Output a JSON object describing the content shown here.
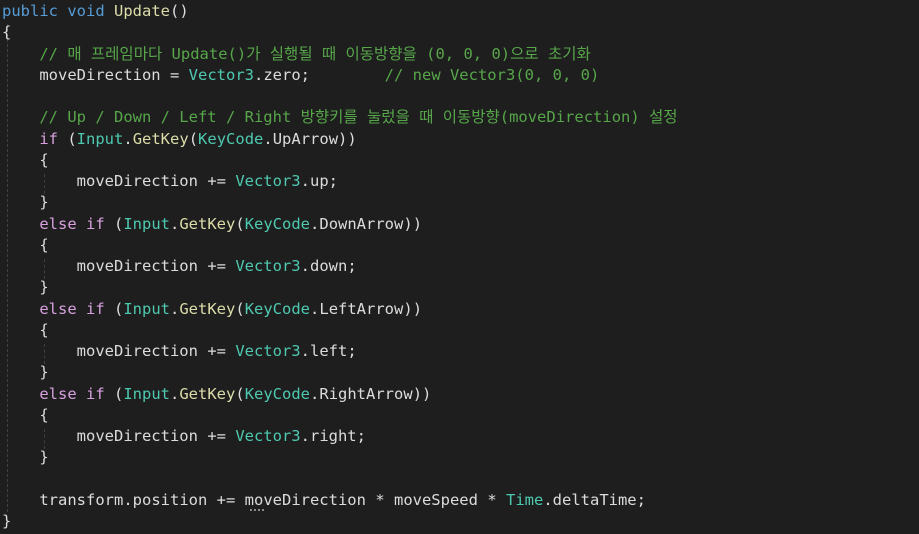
{
  "lines": [
    {
      "segs": [
        [
          "kw",
          "public"
        ],
        [
          "pn",
          " "
        ],
        [
          "kw",
          "void"
        ],
        [
          "pn",
          " "
        ],
        [
          "fn",
          "Update"
        ],
        [
          "pn",
          "()"
        ]
      ]
    },
    {
      "segs": [
        [
          "pn",
          "{"
        ]
      ]
    },
    {
      "segs": [
        [
          "pn",
          "    "
        ],
        [
          "cm",
          "// 매 프레임마다 Update()가 실행될 때 이동방향을 (0, 0, 0)으로 초기화"
        ]
      ]
    },
    {
      "segs": [
        [
          "pn",
          "    "
        ],
        [
          "var",
          "moveDirection"
        ],
        [
          "pn",
          " = "
        ],
        [
          "ty",
          "Vector3"
        ],
        [
          "pn",
          "."
        ],
        [
          "var",
          "zero"
        ],
        [
          "pn",
          ";        "
        ],
        [
          "cm",
          "// new Vector3(0, 0, 0)"
        ]
      ]
    },
    {
      "segs": [
        [
          "pn",
          ""
        ]
      ]
    },
    {
      "segs": [
        [
          "pn",
          "    "
        ],
        [
          "cm",
          "// Up / Down / Left / Right 방향키를 눌렀을 때 이동방향(moveDirection) 설정"
        ]
      ]
    },
    {
      "segs": [
        [
          "pn",
          "    "
        ],
        [
          "kw2",
          "if"
        ],
        [
          "pn",
          " ("
        ],
        [
          "ty",
          "Input"
        ],
        [
          "pn",
          "."
        ],
        [
          "fn",
          "GetKey"
        ],
        [
          "pn",
          "("
        ],
        [
          "ty",
          "KeyCode"
        ],
        [
          "pn",
          "."
        ],
        [
          "var",
          "UpArrow"
        ],
        [
          "pn",
          "))"
        ]
      ]
    },
    {
      "segs": [
        [
          "pn",
          "    {"
        ]
      ]
    },
    {
      "segs": [
        [
          "pn",
          "        "
        ],
        [
          "var",
          "moveDirection"
        ],
        [
          "pn",
          " += "
        ],
        [
          "ty",
          "Vector3"
        ],
        [
          "pn",
          "."
        ],
        [
          "var",
          "up"
        ],
        [
          "pn",
          ";"
        ]
      ]
    },
    {
      "segs": [
        [
          "pn",
          "    }"
        ]
      ]
    },
    {
      "segs": [
        [
          "pn",
          "    "
        ],
        [
          "kw2",
          "else if"
        ],
        [
          "pn",
          " ("
        ],
        [
          "ty",
          "Input"
        ],
        [
          "pn",
          "."
        ],
        [
          "fn",
          "GetKey"
        ],
        [
          "pn",
          "("
        ],
        [
          "ty",
          "KeyCode"
        ],
        [
          "pn",
          "."
        ],
        [
          "var",
          "DownArrow"
        ],
        [
          "pn",
          "))"
        ]
      ]
    },
    {
      "segs": [
        [
          "pn",
          "    {"
        ]
      ]
    },
    {
      "segs": [
        [
          "pn",
          "        "
        ],
        [
          "var",
          "moveDirection"
        ],
        [
          "pn",
          " += "
        ],
        [
          "ty",
          "Vector3"
        ],
        [
          "pn",
          "."
        ],
        [
          "var",
          "down"
        ],
        [
          "pn",
          ";"
        ]
      ]
    },
    {
      "segs": [
        [
          "pn",
          "    }"
        ]
      ]
    },
    {
      "segs": [
        [
          "pn",
          "    "
        ],
        [
          "kw2",
          "else if"
        ],
        [
          "pn",
          " ("
        ],
        [
          "ty",
          "Input"
        ],
        [
          "pn",
          "."
        ],
        [
          "fn",
          "GetKey"
        ],
        [
          "pn",
          "("
        ],
        [
          "ty",
          "KeyCode"
        ],
        [
          "pn",
          "."
        ],
        [
          "var",
          "LeftArrow"
        ],
        [
          "pn",
          "))"
        ]
      ]
    },
    {
      "segs": [
        [
          "pn",
          "    {"
        ]
      ]
    },
    {
      "segs": [
        [
          "pn",
          "        "
        ],
        [
          "var",
          "moveDirection"
        ],
        [
          "pn",
          " += "
        ],
        [
          "ty",
          "Vector3"
        ],
        [
          "pn",
          "."
        ],
        [
          "var",
          "left"
        ],
        [
          "pn",
          ";"
        ]
      ]
    },
    {
      "segs": [
        [
          "pn",
          "    }"
        ]
      ]
    },
    {
      "segs": [
        [
          "pn",
          "    "
        ],
        [
          "kw2",
          "else if"
        ],
        [
          "pn",
          " ("
        ],
        [
          "ty",
          "Input"
        ],
        [
          "pn",
          "."
        ],
        [
          "fn",
          "GetKey"
        ],
        [
          "pn",
          "("
        ],
        [
          "ty",
          "KeyCode"
        ],
        [
          "pn",
          "."
        ],
        [
          "var",
          "RightArrow"
        ],
        [
          "pn",
          "))"
        ]
      ]
    },
    {
      "segs": [
        [
          "pn",
          "    {"
        ]
      ]
    },
    {
      "segs": [
        [
          "pn",
          "        "
        ],
        [
          "var",
          "moveDirection"
        ],
        [
          "pn",
          " += "
        ],
        [
          "ty",
          "Vector3"
        ],
        [
          "pn",
          "."
        ],
        [
          "var",
          "right"
        ],
        [
          "pn",
          ";"
        ]
      ]
    },
    {
      "segs": [
        [
          "pn",
          "    }"
        ]
      ]
    },
    {
      "segs": [
        [
          "pn",
          ""
        ]
      ]
    },
    {
      "segs": [
        [
          "pn",
          "    "
        ],
        [
          "var",
          "transform"
        ],
        [
          "pn",
          "."
        ],
        [
          "var",
          "position"
        ],
        [
          "pn",
          " += "
        ],
        [
          "var",
          "moveDirection"
        ],
        [
          "pn",
          " * "
        ],
        [
          "var",
          "moveSpeed"
        ],
        [
          "pn",
          " * "
        ],
        [
          "ty",
          "Time"
        ],
        [
          "pn",
          "."
        ],
        [
          "var",
          "deltaTime"
        ],
        [
          "pn",
          ";"
        ]
      ]
    },
    {
      "segs": [
        [
          "pn",
          "}"
        ]
      ]
    }
  ],
  "colors": {
    "background": "#1e1e1e",
    "keyword": "#569cd6",
    "control_keyword": "#d8a0df",
    "type": "#4ec9b0",
    "method": "#dcdcaa",
    "comment": "#57a64a",
    "text": "#dcdcdc"
  }
}
